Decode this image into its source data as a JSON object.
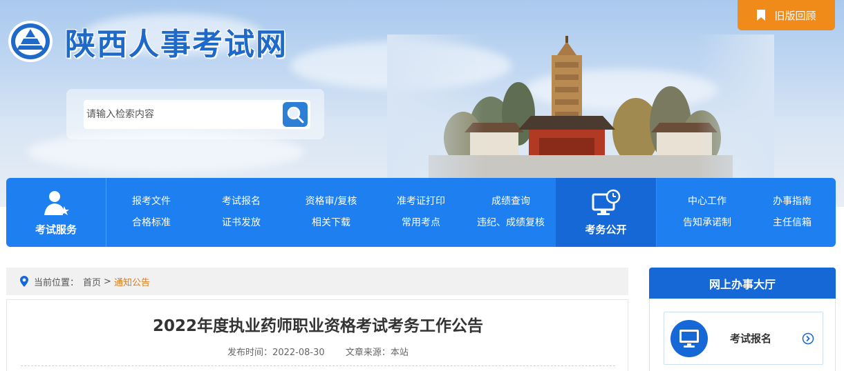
{
  "header": {
    "site_title": "陕西人事考试网",
    "old_version_label": "旧版回顾",
    "search": {
      "placeholder": "请输入检索内容"
    }
  },
  "nav": {
    "exam_service_label": "考试服务",
    "exam_service_links": [
      "报考文件",
      "考试报名",
      "资格审/复核",
      "准考证打印",
      "成绩查询",
      "合格标准",
      "证书发放",
      "相关下载",
      "常用考点",
      "违纪、成绩复核"
    ],
    "exam_public_label": "考务公开",
    "exam_public_links": [
      "中心工作",
      "办事指南",
      "告知承诺制",
      "主任信箱"
    ]
  },
  "breadcrumb": {
    "prefix": "当前位置：",
    "home": "首页",
    "separator": ">",
    "current": "通知公告"
  },
  "article": {
    "title": "2022年度执业药师职业资格考试考务工作公告",
    "publish_label": "发布时间：",
    "publish_date": "2022-08-30",
    "source_label": "文章来源：",
    "source": "本站"
  },
  "sidebar": {
    "title": "网上办事大厅",
    "card_label": "考试报名"
  },
  "colors": {
    "primary_blue": "#1d7ff0",
    "dark_blue": "#1668d6",
    "orange": "#f08a18"
  },
  "icons": [
    "logo-emblem-icon",
    "bookmark-icon",
    "search-icon",
    "user-star-icon",
    "monitor-clock-icon",
    "location-pin-icon",
    "monitor-icon",
    "circle-arrow-right-icon"
  ]
}
